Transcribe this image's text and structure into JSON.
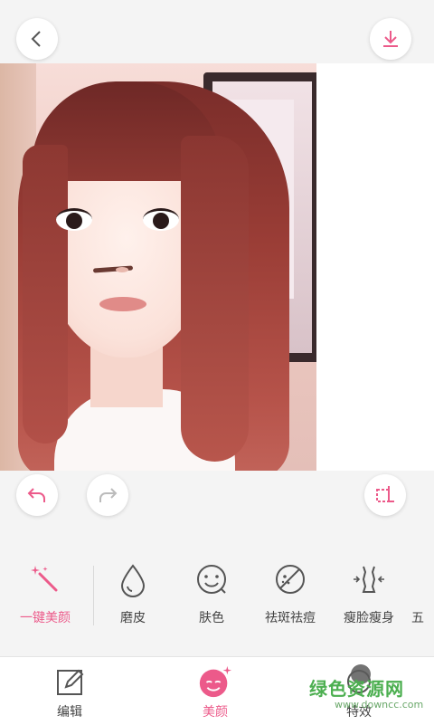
{
  "header": {
    "back_icon": "chevron-left-icon",
    "download_icon": "download-icon"
  },
  "editing_tools": {
    "undo_icon": "undo-icon",
    "redo_icon": "redo-icon",
    "crop_icon": "crop-icon"
  },
  "beauty_tools": [
    {
      "label": "一键美颜",
      "icon": "magic-wand-icon",
      "active": true
    },
    {
      "label": "磨皮",
      "icon": "droplet-icon",
      "active": false
    },
    {
      "label": "肤色",
      "icon": "smiley-face-icon",
      "active": false
    },
    {
      "label": "祛斑祛痘",
      "icon": "blemish-icon",
      "active": false
    },
    {
      "label": "瘦脸瘦身",
      "icon": "body-slim-icon",
      "active": false
    },
    {
      "label": "五",
      "icon": "",
      "active": false
    }
  ],
  "bottom_nav": [
    {
      "label": "编辑",
      "icon": "edit-icon",
      "active": false
    },
    {
      "label": "美颜",
      "icon": "beauty-face-icon",
      "active": true
    },
    {
      "label": "特效",
      "icon": "effects-icon",
      "active": false
    }
  ],
  "watermark": {
    "title": "绿色资源网",
    "url": "www.downcc.com"
  },
  "colors": {
    "accent": "#ec5a8a",
    "icon_gray": "#555555",
    "watermark_green": "#4caf50"
  }
}
